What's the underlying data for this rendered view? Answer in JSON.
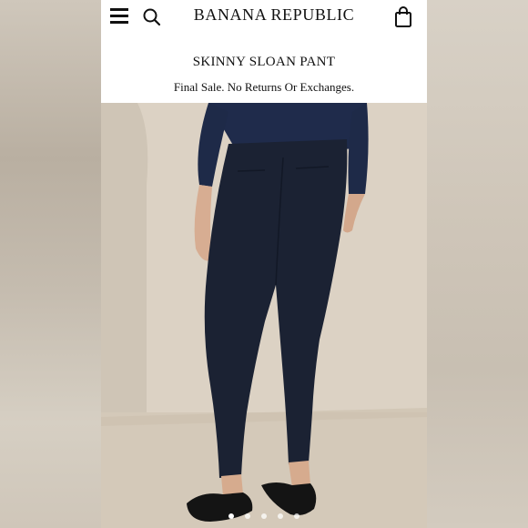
{
  "header": {
    "brand": "BANANA REPUBLIC",
    "menu_icon": "hamburger-menu-icon",
    "search_icon": "search-icon",
    "bag_icon": "shopping-bag-icon"
  },
  "product": {
    "title": "SKINNY SLOAN PANT",
    "note": "Final Sale. No Returns Or Exchanges.",
    "image_alt": "Model wearing navy skinny pants, navy sweater and black loafers"
  },
  "carousel": {
    "count": 5,
    "active_index": 0
  },
  "colors": {
    "pants": "#1b2233",
    "sweater": "#1e2a4a",
    "background": "#d9d0c2",
    "shoes": "#141414"
  }
}
